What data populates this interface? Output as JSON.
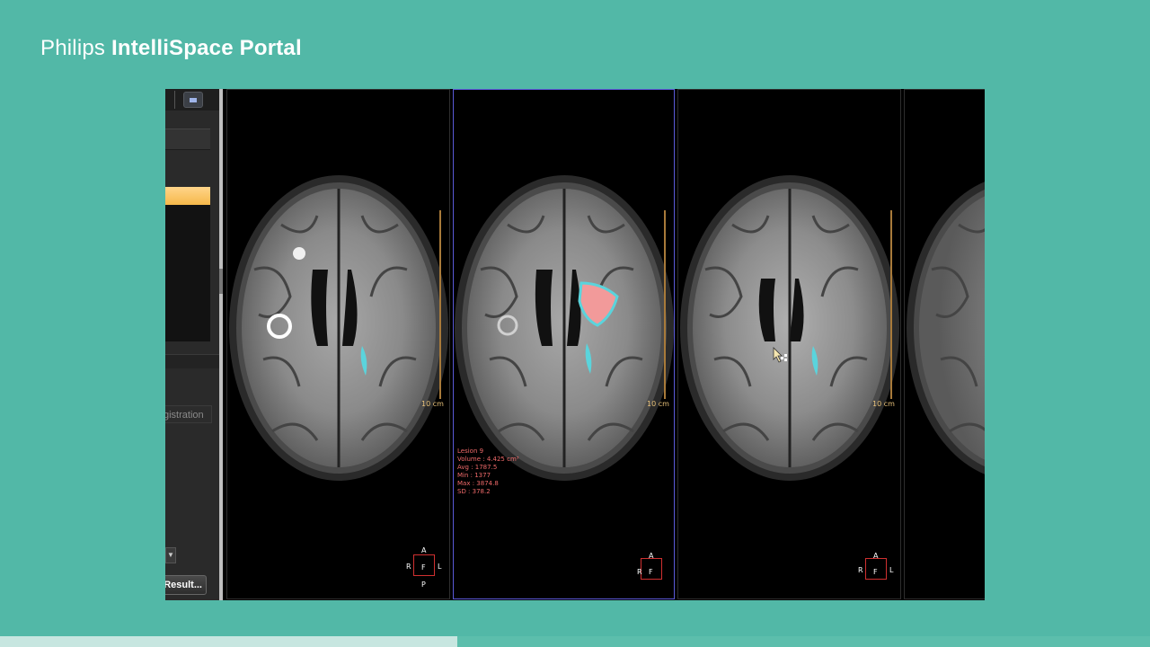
{
  "brand": {
    "light": "Philips",
    "bold": "IntelliSpace Portal"
  },
  "left_panel": {
    "registration_label": "gistration",
    "result_label": "Result..."
  },
  "viewports": [
    {
      "scale_label": "10 cm",
      "orientation": {
        "top": "A",
        "left": "R",
        "center": "F",
        "right": "L",
        "bottom": "P"
      }
    },
    {
      "scale_label": "10 cm",
      "orientation": {
        "top": "A",
        "left": "R",
        "center": "F"
      },
      "lesion": [
        "Lesion 9",
        "Volume : 4.425 cm³",
        "Avg : 1787.5",
        "Min : 1377",
        "Max : 3874.8",
        "SD : 378.2"
      ]
    },
    {
      "scale_label": "10 cm",
      "orientation": {
        "top": "A",
        "left": "R",
        "center": "F",
        "right": "L"
      }
    }
  ],
  "colors": {
    "background": "#52b8a7",
    "lesion_overlay": "#5ad4dc",
    "lesion_fill": "#f29a9a",
    "viewport_active": "#5a5ad8"
  },
  "progress": {
    "fraction": 0.398
  }
}
